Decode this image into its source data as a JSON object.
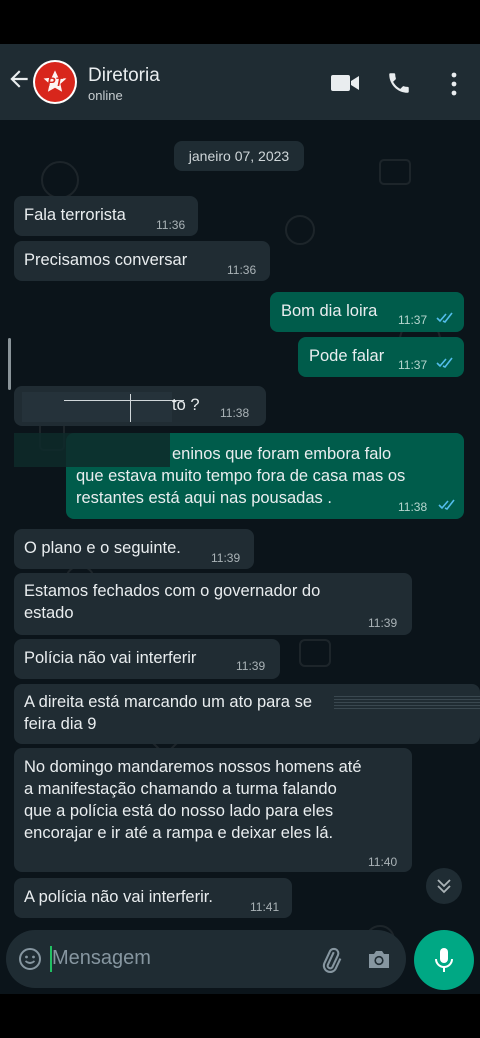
{
  "header": {
    "title": "Diretoria",
    "status": "online",
    "avatar_text": "PT"
  },
  "chat": {
    "date_chip": "janeiro 07, 2023",
    "messages": [
      {
        "dir": "in",
        "text": "Fala terrorista",
        "time": "11:36"
      },
      {
        "dir": "in",
        "text": "Precisamos conversar",
        "time": "11:36"
      },
      {
        "dir": "out",
        "text": "Bom dia loira",
        "time": "11:37"
      },
      {
        "dir": "out",
        "text": "Pode falar",
        "time": "11:37"
      },
      {
        "dir": "in",
        "text": "to ?",
        "time": "11:38"
      },
      {
        "dir": "out",
        "lines": [
          "eninos que foram embora falo",
          "que estava muito tempo fora de casa mas os",
          "restantes está aqui nas pousadas ."
        ],
        "time": "11:38"
      },
      {
        "dir": "in",
        "text": "O plano e o seguinte.",
        "time": "11:39"
      },
      {
        "dir": "in",
        "lines": [
          "Estamos fechados com o governador do",
          "estado"
        ],
        "time": "11:39"
      },
      {
        "dir": "in",
        "text": "Polícia não vai interferir",
        "time": "11:39"
      },
      {
        "dir": "in",
        "lines": [
          "A direita está marcando um ato para se",
          "feira dia 9"
        ]
      },
      {
        "dir": "in",
        "lines": [
          "No domingo mandaremos nossos homens até",
          "a manifestação chamando a turma falando",
          "que a polícia está do nosso lado para eles",
          "encorajar e ir até a rampa e deixar eles lá."
        ],
        "time": "11:40"
      },
      {
        "dir": "in",
        "text": "A polícia não vai interferir.",
        "time": "11:41"
      }
    ]
  },
  "composer": {
    "placeholder": "Mensagem"
  },
  "icons": {
    "back": "arrow-left-icon",
    "video": "video-camera-icon",
    "call": "phone-icon",
    "menu": "more-vertical-icon",
    "emoji": "emoji-icon",
    "attach": "paperclip-icon",
    "camera": "camera-icon",
    "mic": "microphone-icon",
    "scroll_down": "chevron-double-down-icon"
  },
  "colors": {
    "header_bg": "#1f2c33",
    "chat_bg": "#0b141a",
    "incoming_bubble": "#202c33",
    "outgoing_bubble": "#005c4b",
    "read_ticks": "#53bdeb",
    "accent": "#00a884"
  }
}
